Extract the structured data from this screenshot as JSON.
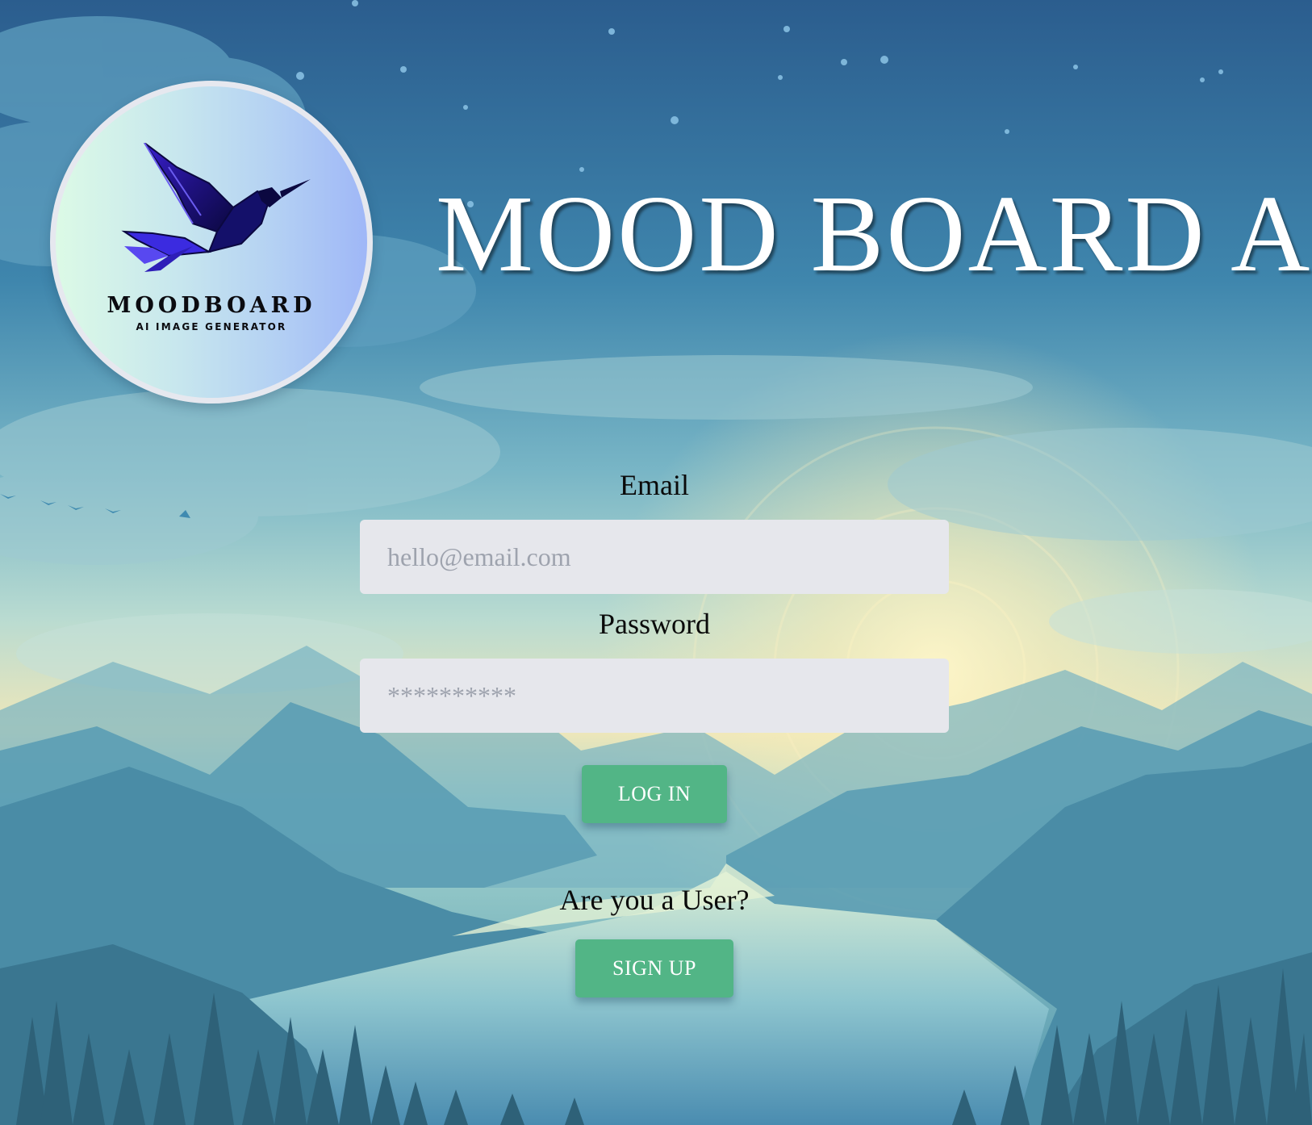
{
  "app": {
    "title": "MOOD BOARD AI"
  },
  "logo": {
    "name": "MOODBOARD",
    "tagline": "AI IMAGE GENERATOR",
    "icon": "hummingbird-icon"
  },
  "form": {
    "email": {
      "label": "Email",
      "placeholder": "hello@email.com",
      "value": ""
    },
    "password": {
      "label": "Password",
      "placeholder": "**********",
      "value": ""
    },
    "login_label": "LOG IN",
    "signup_prompt": "Are you a User?",
    "signup_label": "SIGN UP"
  },
  "colors": {
    "button": "#52b586",
    "input_background": "#e6e7ec",
    "sky_top": "#2b5d8e",
    "sun_glow": "#f7ecb8"
  }
}
